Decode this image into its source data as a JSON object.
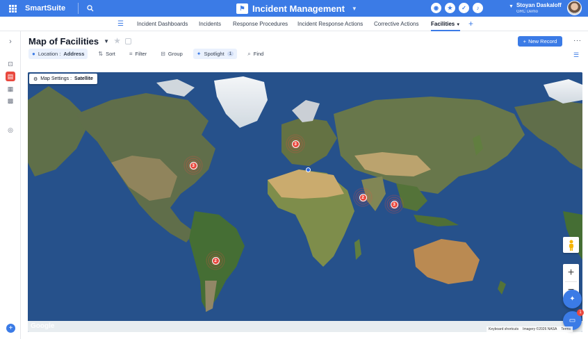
{
  "app": {
    "brand": "SmartSuite",
    "title": "Incident Management",
    "user_name": "Stoyan Daskaloff",
    "user_org": "GRC Demo"
  },
  "tabs": [
    {
      "label": "Incident Dashboards"
    },
    {
      "label": "Incidents"
    },
    {
      "label": "Response Procedures"
    },
    {
      "label": "Incident Response Actions"
    },
    {
      "label": "Corrective Actions"
    },
    {
      "label": "Facilities",
      "active": true
    }
  ],
  "view": {
    "title": "Map of Facilities",
    "new_record_label": "New Record"
  },
  "toolbar": {
    "location_label": "Location :",
    "location_value": "Address",
    "sort": "Sort",
    "filter": "Filter",
    "group": "Group",
    "spotlight": "Spotlight",
    "spotlight_count": "1",
    "find": "Find"
  },
  "map": {
    "settings_label": "Map Settings :",
    "settings_value": "Satellite",
    "google_logo": "Google",
    "keyboard_shortcuts": "Keyboard shortcuts",
    "imagery": "Imagery ©2026 NASA",
    "terms": "Terms",
    "chat_badge": "1",
    "clusters": [
      {
        "region": "North America",
        "count": "3"
      },
      {
        "region": "Europe",
        "count": "3"
      },
      {
        "region": "India",
        "count": "2"
      },
      {
        "region": "Southeast Asia",
        "count": "3"
      },
      {
        "region": "South America",
        "count": "2"
      }
    ]
  },
  "colors": {
    "brand_blue": "#3b7be6",
    "cluster_red": "#e9483e",
    "ocean": "#1e4a84"
  }
}
